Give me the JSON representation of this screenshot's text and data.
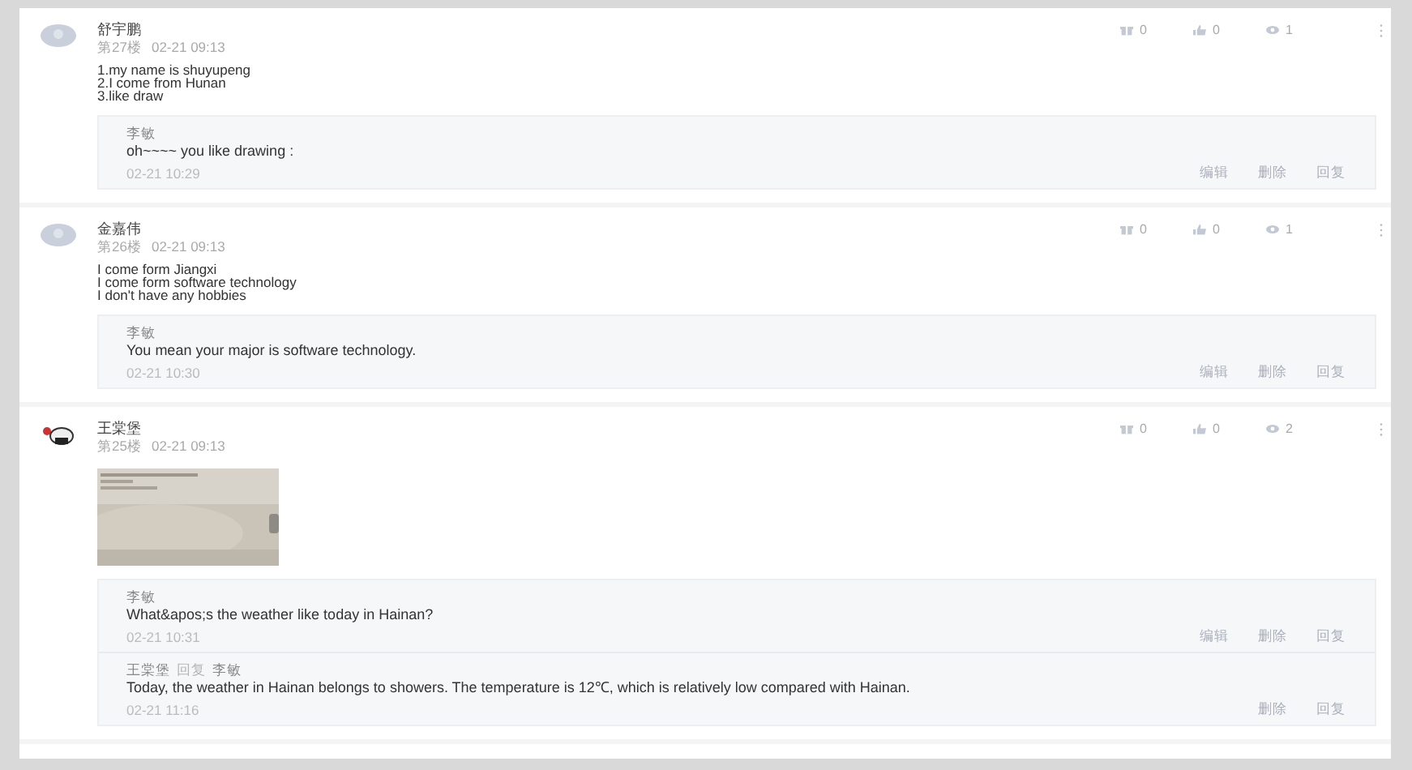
{
  "posts": [
    {
      "author": "舒宇鹏",
      "avatar": {
        "kind": "default"
      },
      "floor": "第27楼",
      "time": "02-21 09:13",
      "stats": {
        "gifts": "0",
        "likes": "0",
        "views": "1"
      },
      "body": [
        "1.my name is shuyupeng",
        "2.I come from Hunan",
        "3.like draw"
      ],
      "replies": [
        {
          "author": "李敏",
          "text": "oh~~~~ you like drawing :",
          "time": "02-21 10:29",
          "actions": [
            "编辑",
            "删除",
            "回复"
          ]
        }
      ]
    },
    {
      "author": "金嘉伟",
      "avatar": {
        "kind": "default"
      },
      "floor": "第26楼",
      "time": "02-21 09:13",
      "stats": {
        "gifts": "0",
        "likes": "0",
        "views": "1"
      },
      "body": [
        "I come form Jiangxi",
        "I come form software technology",
        "I don't have any hobbies"
      ],
      "replies": [
        {
          "author": "李敏",
          "text": "You mean your major is software technology.",
          "time": "02-21 10:30",
          "actions": [
            "编辑",
            "删除",
            "回复"
          ]
        }
      ]
    },
    {
      "author": "王棠堡",
      "avatar": {
        "kind": "cartoon"
      },
      "floor": "第25楼",
      "time": "02-21 09:13",
      "stats": {
        "gifts": "0",
        "likes": "0",
        "views": "2"
      },
      "attachment": {
        "kind": "picture"
      },
      "replies": [
        {
          "author": "李敏",
          "text": "What&apos;s the weather like today in Hainan?",
          "time": "02-21 10:31",
          "actions": [
            "编辑",
            "删除",
            "回复"
          ]
        },
        {
          "author": "王棠堡",
          "verb": "回复",
          "target": "李敏",
          "text": "Today, the weather in Hainan belongs to showers. The temperature is 12℃, which is relatively low compared with Hainan.",
          "time": "02-21 11:16",
          "actions": [
            "删除",
            "回复"
          ]
        }
      ]
    }
  ]
}
